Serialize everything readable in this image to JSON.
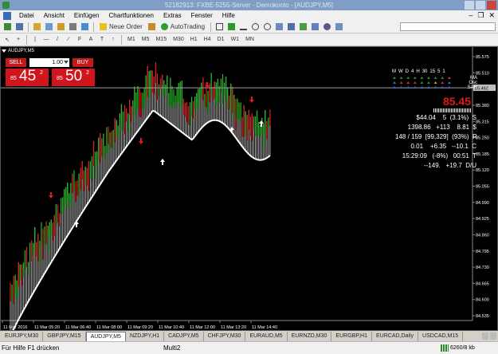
{
  "window": {
    "title": "52182913: FXBE-5255-Server - Demokonto - [AUDJPY,M5]"
  },
  "menu": [
    "Datei",
    "Ansicht",
    "Einfügen",
    "Chartfunktionen",
    "Extras",
    "Fenster",
    "Hilfe"
  ],
  "toolbar": {
    "new_order": "Neue Order",
    "auto_trading": "AutoTrading",
    "timeframes": [
      "M1",
      "M5",
      "M15",
      "M30",
      "H1",
      "H4",
      "D1",
      "W1",
      "MN"
    ]
  },
  "chart": {
    "symbol_label": "AUDJPY,M5",
    "price_ticks": [
      "85.575",
      "85.510",
      "85.445",
      "85.380",
      "85.315",
      "85.250",
      "85.185",
      "85.120",
      "85.055",
      "84.990",
      "84.925",
      "84.860",
      "84.795",
      "84.730",
      "84.665",
      "84.600",
      "84.535"
    ],
    "current_price_tag": "85.462",
    "time_ticks": [
      "11 Mar 2016",
      "11 Mar 05:20",
      "11 Mar 06:40",
      "11 Mar 08:00",
      "11 Mar 09:20",
      "11 Mar 10:40",
      "11 Mar 12:00",
      "11 Mar 13:20",
      "11 Mar 14:40"
    ],
    "colors": {
      "bull": "#1fbd1f",
      "bear": "#e01b1b",
      "band": "#cfcfcf",
      "sar": "#ffffff",
      "price_line": "#a0a0a0"
    }
  },
  "trade_panel": {
    "sell_label": "SELL",
    "buy_label": "BUY",
    "lot": "1.00",
    "sell_price": {
      "prefix": "85",
      "big": "45",
      "sup": "2"
    },
    "buy_price": {
      "prefix": "85",
      "big": "50",
      "sup": "2"
    }
  },
  "indicator_panel": {
    "timeframes": [
      "M",
      "W",
      "D",
      "4",
      "H",
      "30",
      "15",
      "5",
      "1"
    ],
    "labels": [
      "MA",
      "Osc",
      "SAR"
    ]
  },
  "stats": {
    "price": "85.45",
    "rows": [
      "$44.04    5  (3.1%)  S",
      "1398.86   +113    8.81  $",
      "148 / 159  [99,329]  (93%)  R",
      "0.01    +6.35   --10.1  C",
      "15:29:09   (-8%)   00:51  T",
      "--149.   +19.7  D/U"
    ]
  },
  "tabs": {
    "items": [
      "EURJPY,M30",
      "GBPJPY,M15",
      "AUDJPY,M5",
      "NZDJPY,H1",
      "CADJPY,M5",
      "CHFJPY,M30",
      "EURAUD,M5",
      "EURNZD,M30",
      "EURGBP,H1",
      "EURCAD,Daily",
      "USDCAD,M15"
    ],
    "active": 2
  },
  "status": {
    "help": "Für Hilfe F1 drücken",
    "profile": "Multi2",
    "traffic": "6260/8 kb"
  }
}
